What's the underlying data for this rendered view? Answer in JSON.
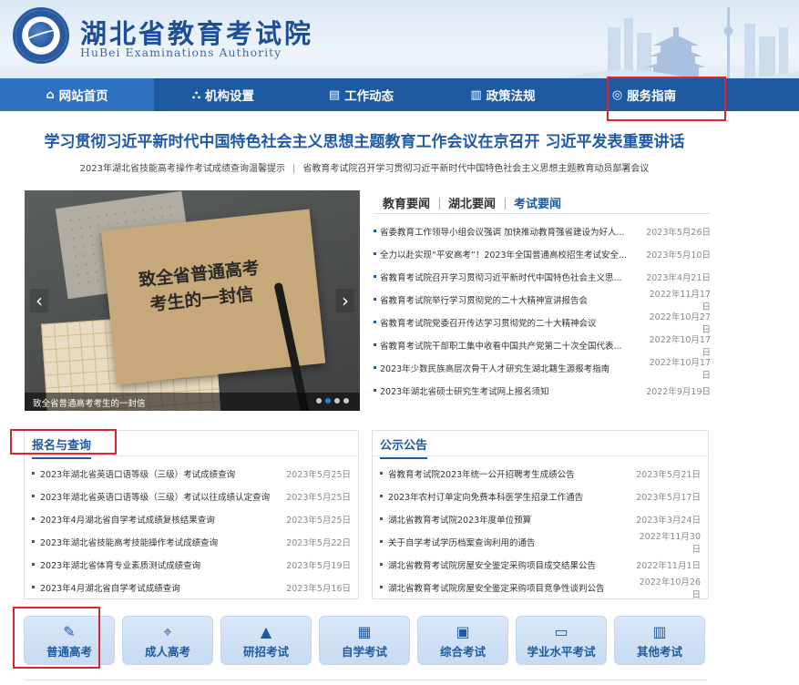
{
  "header": {
    "title": "湖北省教育考试院",
    "subtitle": "HuBei Examinations Authority"
  },
  "nav": [
    {
      "label": "网站首页",
      "icon": "home-icon"
    },
    {
      "label": "机构设置",
      "icon": "org-chart-icon"
    },
    {
      "label": "工作动态",
      "icon": "document-icon"
    },
    {
      "label": "政策法规",
      "icon": "book-icon"
    },
    {
      "label": "服务指南",
      "icon": "compass-icon"
    }
  ],
  "headline": "学习贯彻习近平新时代中国特色社会主义思想主题教育工作会议在京召开 习近平发表重要讲话",
  "sublinks": [
    "2023年湖北省技能高考操作考试成绩查询温馨提示",
    "省教育考试院召开学习贯彻习近平新时代中国特色社会主义思想主题教育动员部署会议"
  ],
  "carousel": {
    "title_line1": "致全省普通高考",
    "title_line2": "考生的一封信",
    "caption": "致全省普通高考考生的一封信",
    "prev": "‹",
    "next": "›"
  },
  "news": {
    "tabs": [
      "教育要闻",
      "湖北要闻",
      "考试要闻"
    ],
    "items": [
      {
        "title": "省委教育工作领导小组会议强调 加快推动教育强省建设为好人...",
        "date": "2023年5月26日"
      },
      {
        "title": "全力以赴实现“平安高考”！2023年全国普通高校招生考试安全...",
        "date": "2023年5月10日"
      },
      {
        "title": "省教育考试院召开学习贯彻习近平新时代中国特色社会主义思...",
        "date": "2023年4月21日"
      },
      {
        "title": "省教育考试院举行学习贯彻党的二十大精神宣讲报告会",
        "date": "2022年11月17日"
      },
      {
        "title": "省教育考试院党委召开传达学习贯彻党的二十大精神会议",
        "date": "2022年10月27日"
      },
      {
        "title": "省教育考试院干部职工集中收看中国共产党第二十次全国代表...",
        "date": "2022年10月17日"
      },
      {
        "title": "2023年少数民族高层次骨干人才研究生湖北籍生源报考指南",
        "date": "2022年10月17日"
      },
      {
        "title": "2023年湖北省硕士研究生考试网上报名须知",
        "date": "2022年9月19日"
      }
    ]
  },
  "register": {
    "title": "报名与查询",
    "items": [
      {
        "title": "2023年湖北省英语口语等级（三级）考试成绩查询",
        "date": "2023年5月25日"
      },
      {
        "title": "2023年湖北省英语口语等级（三级）考试以往成绩认定查询",
        "date": "2023年5月25日"
      },
      {
        "title": "2023年4月湖北省自学考试成绩复核结果查询",
        "date": "2023年5月25日"
      },
      {
        "title": "2023年湖北省技能高考技能操作考试成绩查询",
        "date": "2023年5月22日"
      },
      {
        "title": "2023年湖北省体育专业素质测试成绩查询",
        "date": "2023年5月19日"
      },
      {
        "title": "2023年4月湖北省自学考试成绩查询",
        "date": "2023年5月16日"
      }
    ]
  },
  "notice": {
    "title": "公示公告",
    "items": [
      {
        "title": "省教育考试院2023年统一公开招聘考生成绩公告",
        "date": "2023年5月21日"
      },
      {
        "title": "2023年农村订单定向免费本科医学生招录工作通告",
        "date": "2023年5月17日"
      },
      {
        "title": "湖北省教育考试院2023年度单位预算",
        "date": "2023年3月24日"
      },
      {
        "title": "关于自学考试学历档案查询利用的通告",
        "date": "2022年11月30日"
      },
      {
        "title": "湖北省教育考试院房屋安全鉴定采购项目成交结果公告",
        "date": "2022年11月1日"
      },
      {
        "title": "湖北省教育考试院房屋安全鉴定采购项目竞争性谈判公告",
        "date": "2022年10月26日"
      }
    ]
  },
  "services": [
    {
      "label": "普通高考",
      "icon": "person-pen-icon"
    },
    {
      "label": "成人高考",
      "icon": "location-pin-icon"
    },
    {
      "label": "研招考试",
      "icon": "graduation-cap-icon"
    },
    {
      "label": "自学考试",
      "icon": "book-icon"
    },
    {
      "label": "综合考试",
      "icon": "clipboard-icon"
    },
    {
      "label": "学业水平考试",
      "icon": "certificate-icon"
    },
    {
      "label": "其他考试",
      "icon": "open-book-icon"
    }
  ],
  "colors": {
    "primary": "#1d5aa1",
    "nav_active": "#2f72c2",
    "highlight_box": "#e0242e",
    "service_bg": "#d2e2f6"
  }
}
